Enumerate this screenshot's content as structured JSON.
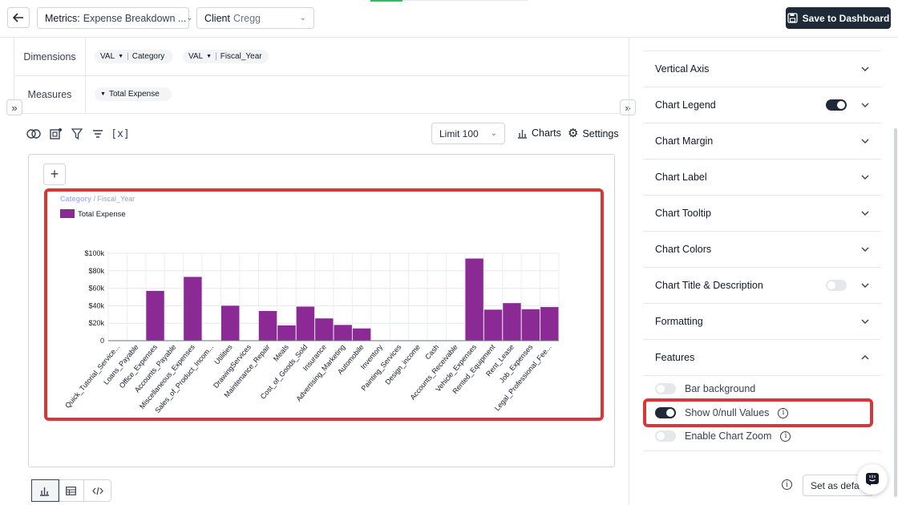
{
  "header": {
    "metrics_label": "Metrics:",
    "metrics_value": "Expense Breakdown ...",
    "client_label": "Client",
    "client_value": "Cregg",
    "save_label": "Save to Dashboard"
  },
  "query": {
    "dimensions_label": "Dimensions",
    "dimensions": [
      {
        "agg": "VAL",
        "field": "Category"
      },
      {
        "agg": "VAL",
        "field": "Fiscal_Year"
      }
    ],
    "measures_label": "Measures",
    "measures": [
      "Total Expense"
    ]
  },
  "toolbar": {
    "limit_label": "Limit 100",
    "charts_label": "Charts",
    "settings_label": "Settings",
    "variable_label": "[x]"
  },
  "chart_data": {
    "type": "bar",
    "breadcrumb_primary": "Category",
    "breadcrumb_sep": " / ",
    "breadcrumb_secondary": "Fiscal_Year",
    "legend": [
      "Total Expense"
    ],
    "color": "#8b2a94",
    "categories": [
      "Quick_Tutorial_Service...",
      "Loans_Payable",
      "Office_Expenses",
      "Accounts_Payable",
      "Miscellaneous_Expenses",
      "Sales_of_Product_Incom...",
      "Utilities",
      "DrawingServices",
      "Maintenance_Repair",
      "Meals",
      "Cost_of_Goods_Sold",
      "Insurance",
      "Advertising_Marketing",
      "Automobile",
      "Inventory",
      "Painting_Services",
      "Design_income",
      "Cash",
      "Accounts_Receivable",
      "Vehicle_Expenses",
      "Rented_Equipment",
      "Rent_Lease",
      "Job_Expenses",
      "Legal_Professional_Fee..."
    ],
    "values": [
      0,
      0,
      57000,
      0,
      73000,
      0,
      40000,
      0,
      34000,
      17500,
      39000,
      25500,
      18000,
      14000,
      0,
      0,
      0,
      0,
      0,
      94000,
      35500,
      43000,
      36000,
      38500
    ],
    "y_ticks": [
      "0",
      "$20k",
      "$40k",
      "$60k",
      "$80k",
      "$100k"
    ],
    "ylim": [
      0,
      100000
    ],
    "grid": true
  },
  "panel": {
    "rows": [
      {
        "label": "Vertical Axis",
        "toggle": null,
        "expanded": false
      },
      {
        "label": "Chart Legend",
        "toggle": "on",
        "expanded": false
      },
      {
        "label": "Chart Margin",
        "toggle": null,
        "expanded": false
      },
      {
        "label": "Chart Label",
        "toggle": null,
        "expanded": false
      },
      {
        "label": "Chart Tooltip",
        "toggle": null,
        "expanded": false
      },
      {
        "label": "Chart Colors",
        "toggle": null,
        "expanded": false
      },
      {
        "label": "Chart Title & Description",
        "toggle": "off",
        "expanded": false
      },
      {
        "label": "Formatting",
        "toggle": null,
        "expanded": false
      },
      {
        "label": "Features",
        "toggle": null,
        "expanded": true
      }
    ],
    "features": [
      {
        "label": "Bar background",
        "toggle": "off",
        "info": false
      },
      {
        "label": "Show 0/null Values",
        "toggle": "on",
        "info": true
      },
      {
        "label": "Enable Chart Zoom",
        "toggle": "off",
        "info": true
      }
    ],
    "set_default_label": "Set as defau..."
  }
}
